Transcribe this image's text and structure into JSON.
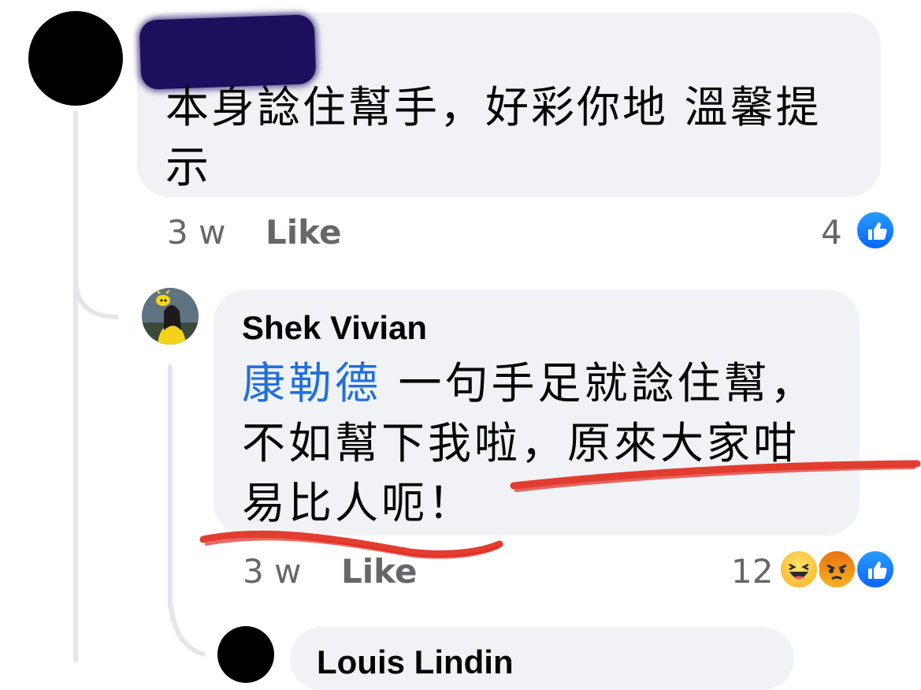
{
  "comment_top": {
    "text": "本身諗住幫手，好彩你地 溫馨提示",
    "time": "3 w",
    "like_label": "Like",
    "reaction_count": "4",
    "reactions": [
      "like-icon"
    ]
  },
  "reply": {
    "author": "Shek Vivian",
    "mention": "康勒德",
    "text": " 一句手足就諗住幫，不如幫下我啦，原來大家咁易比人呃！",
    "time": "3 w",
    "like_label": "Like",
    "reaction_count": "12",
    "reactions": [
      "haha-icon",
      "angry-icon",
      "like-icon"
    ]
  },
  "next_reply": {
    "author": "Louis Lindin"
  },
  "colors": {
    "bubble": "#f0f2f5",
    "thread_line": "#e4e6eb",
    "mention": "#216fdb",
    "meta": "#65676b",
    "scribble": "#e0281b"
  }
}
